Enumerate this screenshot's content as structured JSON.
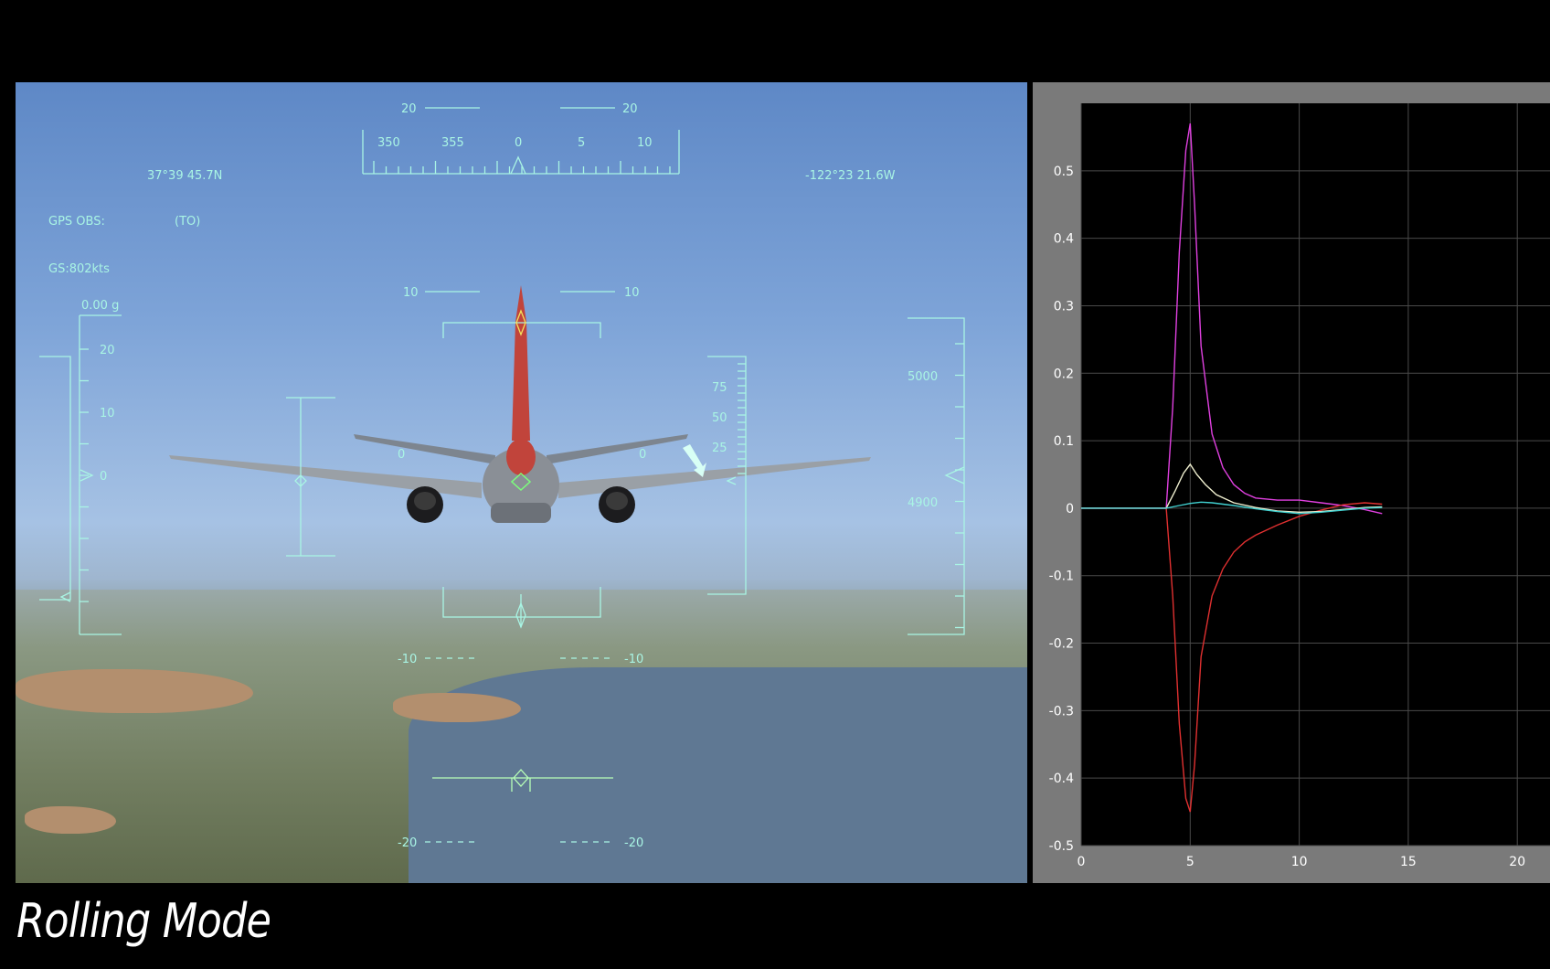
{
  "hud": {
    "latitude": "37°39 45.7N",
    "longitude": "-122°23 21.6W",
    "gps_obs_label": "GPS OBS:",
    "gps_obs_value": "(TO)",
    "ground_speed": "GS:802kts",
    "g_load": "0.00 g",
    "heading_ticks": [
      "350",
      "355",
      "0",
      "5",
      "10"
    ],
    "pitch_labels": {
      "p20": "20",
      "p10": "10",
      "m10": "-10",
      "m20": "-20",
      "zero": "0"
    },
    "left_scale": [
      "20",
      "10",
      "0"
    ],
    "speed_scale": [
      "75",
      "50",
      "25"
    ],
    "altitude_scale": [
      "5000",
      "4900"
    ]
  },
  "caption": "Rolling Mode",
  "colors": {
    "hud": "#a9f5e4",
    "series_magenta": "#e040e0",
    "series_red": "#e03030",
    "series_white": "#f0f0d0",
    "series_cyan": "#40d0d0"
  },
  "chart_data": {
    "type": "line",
    "xlim": [
      0,
      21.5
    ],
    "ylim": [
      -0.5,
      0.6
    ],
    "xticks": [
      "0",
      "5",
      "10",
      "15",
      "20"
    ],
    "yticks": [
      "0.5",
      "0.4",
      "0.3",
      "0.2",
      "0.1",
      "0",
      "-0.1",
      "-0.2",
      "-0.3",
      "-0.4",
      "-0.5"
    ],
    "grid": true,
    "series": [
      {
        "color": "magenta",
        "x": [
          0,
          3.9,
          4.2,
          4.5,
          4.8,
          5.0,
          5.2,
          5.5,
          6.0,
          6.5,
          7.0,
          7.5,
          8.0,
          9.0,
          10.0,
          11.0,
          12.0,
          13.0,
          13.8
        ],
        "y": [
          0,
          0,
          0.15,
          0.38,
          0.53,
          0.57,
          0.45,
          0.24,
          0.11,
          0.06,
          0.035,
          0.022,
          0.015,
          0.012,
          0.012,
          0.008,
          0.004,
          -0.002,
          -0.008
        ]
      },
      {
        "color": "red",
        "x": [
          0,
          3.9,
          4.2,
          4.5,
          4.8,
          5.0,
          5.2,
          5.5,
          6.0,
          6.5,
          7.0,
          7.5,
          8.0,
          9.0,
          10.0,
          11.0,
          12.0,
          13.0,
          13.8
        ],
        "y": [
          0,
          0,
          -0.13,
          -0.32,
          -0.43,
          -0.45,
          -0.38,
          -0.22,
          -0.13,
          -0.09,
          -0.065,
          -0.05,
          -0.04,
          -0.025,
          -0.012,
          -0.003,
          0.005,
          0.008,
          0.006
        ]
      },
      {
        "color": "white",
        "x": [
          0,
          3.9,
          4.3,
          4.7,
          5.0,
          5.3,
          5.7,
          6.2,
          7.0,
          8.0,
          9.0,
          10.0,
          11.0,
          12.0,
          13.0,
          13.8
        ],
        "y": [
          0,
          0,
          0.025,
          0.052,
          0.065,
          0.05,
          0.035,
          0.02,
          0.008,
          0.001,
          -0.004,
          -0.006,
          -0.005,
          -0.002,
          0.001,
          0.002
        ]
      },
      {
        "color": "cyan",
        "x": [
          0,
          3.9,
          4.5,
          5.0,
          5.5,
          6.0,
          7.0,
          8.0,
          9.0,
          10.0,
          11.0,
          12.0,
          13.0,
          13.8
        ],
        "y": [
          0,
          0,
          0.004,
          0.007,
          0.009,
          0.008,
          0.004,
          -0.001,
          -0.005,
          -0.008,
          -0.006,
          -0.003,
          0.0,
          0.001
        ]
      }
    ]
  }
}
